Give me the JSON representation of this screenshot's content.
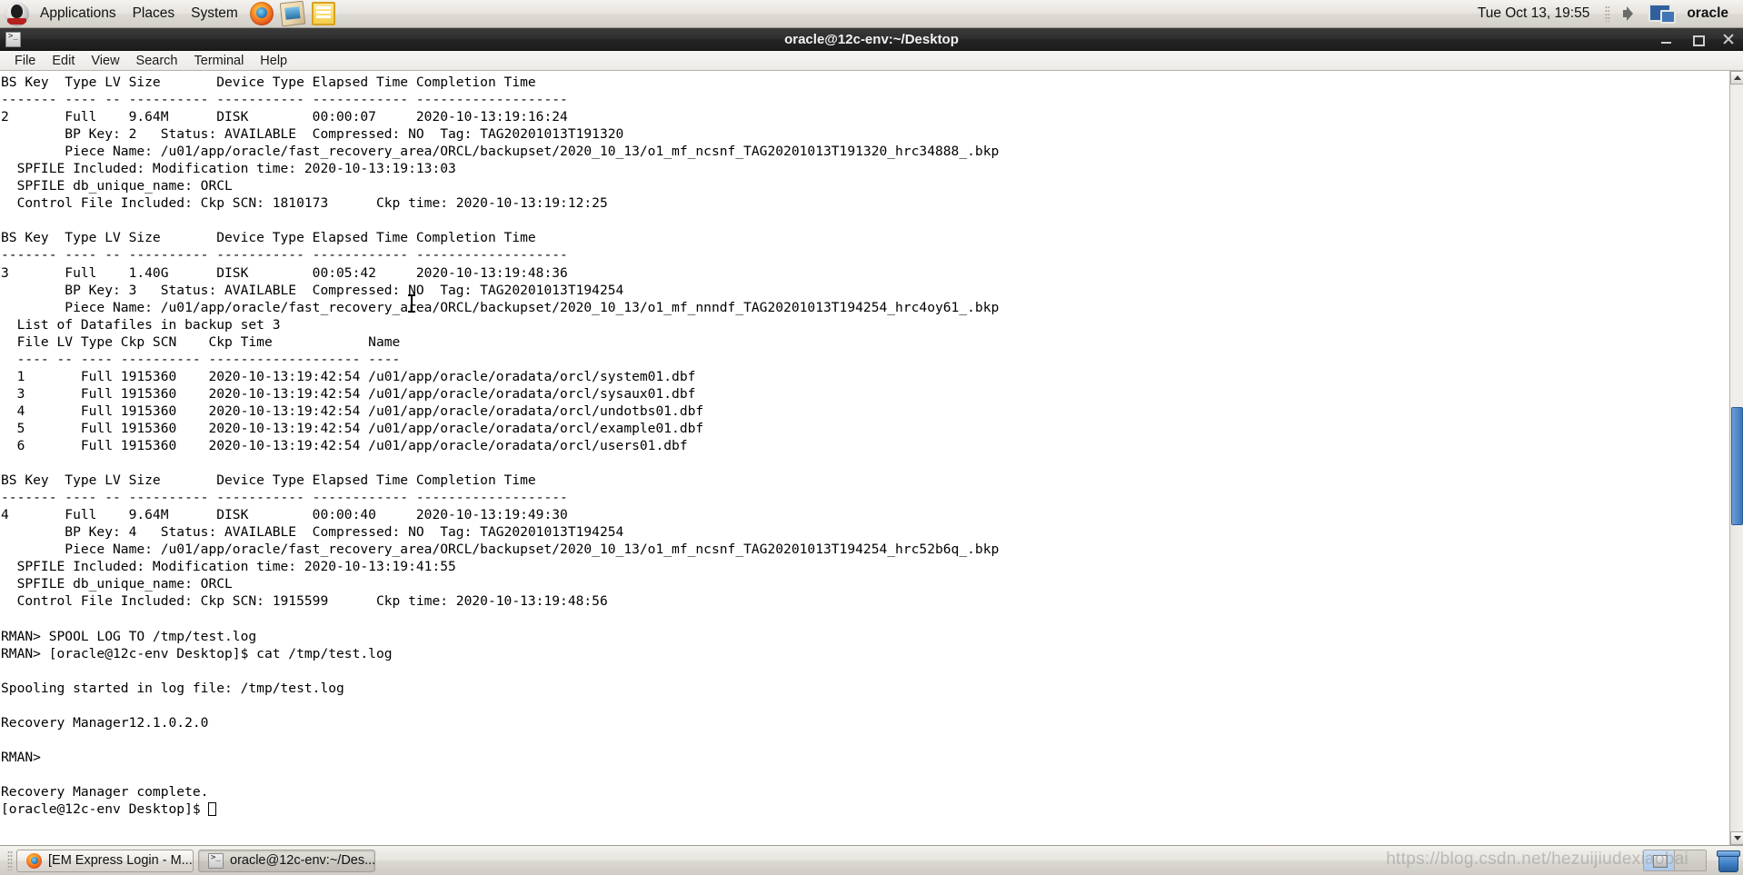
{
  "top_panel": {
    "logo_icon": "oracle-tux-logo",
    "menus": [
      "Applications",
      "Places",
      "System"
    ],
    "launchers": [
      {
        "name": "firefox-icon",
        "label": "Firefox Web Browser"
      },
      {
        "name": "mail-photo-icon",
        "label": "Email / Image Viewer"
      },
      {
        "name": "text-editor-icon",
        "label": "Text Editor"
      }
    ],
    "clock": "Tue Oct 13, 19:55",
    "volume_icon": "speaker-icon",
    "display_icon": "display-icon",
    "user": "oracle"
  },
  "window": {
    "title": "oracle@12c-env:~/Desktop",
    "icon": "terminal-icon",
    "buttons": {
      "minimize": "minimize-button",
      "maximize": "maximize-button",
      "close": "close-button"
    },
    "menubar": [
      "File",
      "Edit",
      "View",
      "Search",
      "Terminal",
      "Help"
    ]
  },
  "terminal": {
    "content": "BS Key  Type LV Size       Device Type Elapsed Time Completion Time\n------- ---- -- ---------- ----------- ------------ -------------------\n2       Full    9.64M      DISK        00:00:07     2020-10-13:19:16:24\n        BP Key: 2   Status: AVAILABLE  Compressed: NO  Tag: TAG20201013T191320\n        Piece Name: /u01/app/oracle/fast_recovery_area/ORCL/backupset/2020_10_13/o1_mf_ncsnf_TAG20201013T191320_hrc34888_.bkp\n  SPFILE Included: Modification time: 2020-10-13:19:13:03\n  SPFILE db_unique_name: ORCL\n  Control File Included: Ckp SCN: 1810173      Ckp time: 2020-10-13:19:12:25\n\nBS Key  Type LV Size       Device Type Elapsed Time Completion Time\n------- ---- -- ---------- ----------- ------------ -------------------\n3       Full    1.40G      DISK        00:05:42     2020-10-13:19:48:36\n        BP Key: 3   Status: AVAILABLE  Compressed: NO  Tag: TAG20201013T194254\n        Piece Name: /u01/app/oracle/fast_recovery_area/ORCL/backupset/2020_10_13/o1_mf_nnndf_TAG20201013T194254_hrc4oy61_.bkp\n  List of Datafiles in backup set 3\n  File LV Type Ckp SCN    Ckp Time            Name\n  ---- -- ---- ---------- ------------------- ----\n  1       Full 1915360    2020-10-13:19:42:54 /u01/app/oracle/oradata/orcl/system01.dbf\n  3       Full 1915360    2020-10-13:19:42:54 /u01/app/oracle/oradata/orcl/sysaux01.dbf\n  4       Full 1915360    2020-10-13:19:42:54 /u01/app/oracle/oradata/orcl/undotbs01.dbf\n  5       Full 1915360    2020-10-13:19:42:54 /u01/app/oracle/oradata/orcl/example01.dbf\n  6       Full 1915360    2020-10-13:19:42:54 /u01/app/oracle/oradata/orcl/users01.dbf\n\nBS Key  Type LV Size       Device Type Elapsed Time Completion Time\n------- ---- -- ---------- ----------- ------------ -------------------\n4       Full    9.64M      DISK        00:00:40     2020-10-13:19:49:30\n        BP Key: 4   Status: AVAILABLE  Compressed: NO  Tag: TAG20201013T194254\n        Piece Name: /u01/app/oracle/fast_recovery_area/ORCL/backupset/2020_10_13/o1_mf_ncsnf_TAG20201013T194254_hrc52b6q_.bkp\n  SPFILE Included: Modification time: 2020-10-13:19:41:55\n  SPFILE db_unique_name: ORCL\n  Control File Included: Ckp SCN: 1915599      Ckp time: 2020-10-13:19:48:56\n\nRMAN> SPOOL LOG TO /tmp/test.log\nRMAN> [oracle@12c-env Desktop]$ cat /tmp/test.log\n\nSpooling started in log file: /tmp/test.log\n\nRecovery Manager12.1.0.2.0\n\nRMAN>\n\nRecovery Manager complete.\n",
    "prompt": "[oracle@12c-env Desktop]$ ",
    "cursor": "block-cursor",
    "scrollbar": {
      "up_arrow": "scroll-up-arrow",
      "down_arrow": "scroll-down-arrow",
      "thumb": "scroll-thumb"
    }
  },
  "bottom_panel": {
    "tasks": [
      {
        "label": "[EM Express Login - M...",
        "icon": "firefox-icon",
        "active": false
      },
      {
        "label": "oracle@12c-env:~/Des...",
        "icon": "terminal-icon",
        "active": true
      }
    ],
    "watermark": "https://blog.csdn.net/hezuijiudexiaobai",
    "workspaces": 2,
    "trash_icon": "trash-icon"
  },
  "colors": {
    "panel_bg": "#e8e5e0",
    "titlebar_bg": "#2a2a2a",
    "terminal_bg": "#ffffff",
    "terminal_fg": "#000000",
    "scroll_thumb": "#3c74bb"
  }
}
